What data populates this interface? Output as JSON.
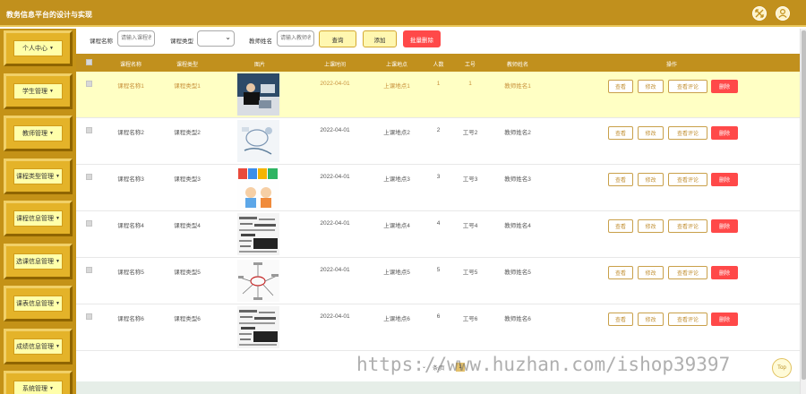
{
  "app": {
    "title": "教务信息平台的设计与实现"
  },
  "header_icons": {
    "left": "fullscreen-icon",
    "right": "user-icon"
  },
  "sidebar": {
    "items": [
      {
        "label": "个人中心"
      },
      {
        "label": "学生管理"
      },
      {
        "label": "教师管理"
      },
      {
        "label": "课程类型管理"
      },
      {
        "label": "课程信息管理"
      },
      {
        "label": "选课信息管理"
      },
      {
        "label": "课表信息管理"
      },
      {
        "label": "成绩信息管理"
      },
      {
        "label": "系统管理"
      }
    ]
  },
  "toolbar": {
    "course_name_label": "课程名称",
    "course_name_placeholder": "请输入课程名",
    "course_type_label": "课程类型",
    "teacher_name_label": "教师姓名",
    "teacher_name_placeholder": "请输入教师名",
    "search_label": "查询",
    "add_label": "添加",
    "batch_delete_label": "批量删除"
  },
  "table": {
    "headers": [
      "课程名称",
      "课程类型",
      "图片",
      "上课时间",
      "上课地点",
      "人数",
      "工号",
      "教师姓名",
      "操作"
    ],
    "rows": [
      {
        "name": "课程名称1",
        "type": "课程类型1",
        "image": "photo-meeting",
        "time": "2022-04-01",
        "place": "上课地点1",
        "count": "1",
        "job_no": "1",
        "teacher": "教师姓名1"
      },
      {
        "name": "课程名称2",
        "type": "课程类型2",
        "image": "photo-sketch",
        "time": "2022-04-01",
        "place": "上课地点2",
        "count": "2",
        "job_no": "工号2",
        "teacher": "教师姓名2"
      },
      {
        "name": "课程名称3",
        "type": "课程类型3",
        "image": "photo-abcd",
        "time": "2022-04-01",
        "place": "上课地点3",
        "count": "3",
        "job_no": "工号3",
        "teacher": "教师姓名3"
      },
      {
        "name": "课程名称4",
        "type": "课程类型4",
        "image": "photo-words",
        "time": "2022-04-01",
        "place": "上课地点4",
        "count": "4",
        "job_no": "工号4",
        "teacher": "教师姓名4"
      },
      {
        "name": "课程名称5",
        "type": "课程类型5",
        "image": "photo-mindmap",
        "time": "2022-04-01",
        "place": "上课地点5",
        "count": "5",
        "job_no": "工号5",
        "teacher": "教师姓名5"
      },
      {
        "name": "课程名称6",
        "type": "课程类型6",
        "image": "photo-words",
        "time": "2022-04-01",
        "place": "上课地点6",
        "count": "6",
        "job_no": "工号6",
        "teacher": "教师姓名6"
      }
    ],
    "actions": {
      "view": "查看",
      "edit": "修改",
      "view_comments": "查看评论",
      "delete": "删除"
    }
  },
  "pager": {
    "per_page_text": "条/页",
    "current_page": "1"
  },
  "watermark": "https://www.huzhan.com/ishop39397",
  "top_button": "Top",
  "colors": {
    "brand": "#c1901d",
    "highlight_row": "#ffffc4",
    "danger": "#ff4949"
  }
}
